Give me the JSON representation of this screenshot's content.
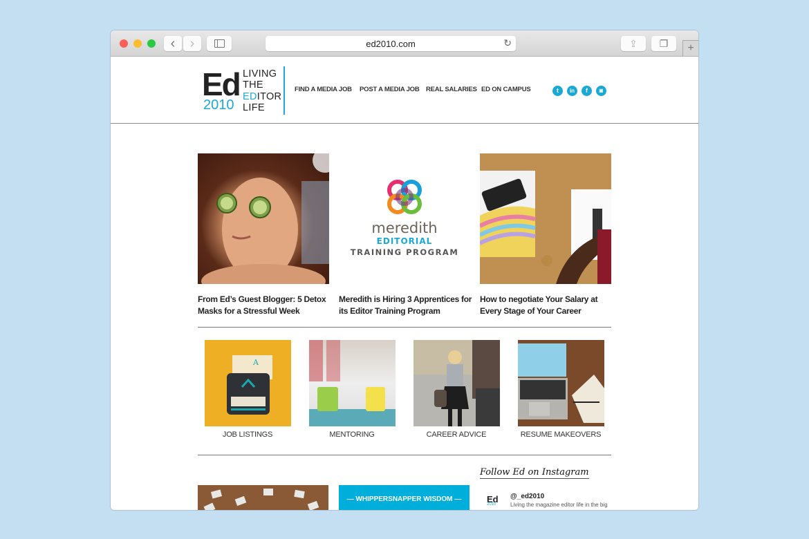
{
  "browser": {
    "url": "ed2010.com",
    "icons": {
      "back": "chevron-left-icon",
      "forward": "chevron-right-icon",
      "sidebar": "sidebar-icon",
      "reload": "reload-icon",
      "share": "share-icon",
      "tabs": "tabs-icon",
      "new_tab": "plus-icon"
    },
    "glyphs": {
      "back": "‹",
      "forward": "›",
      "reload": "↻",
      "share": "⇪",
      "tabs": "❐",
      "new_tab": "+"
    }
  },
  "site": {
    "logo": {
      "ed": "Ed",
      "year": "2010",
      "tag_line1": "LIVING",
      "tag_line2": "THE",
      "tag_line3_blue": "ED",
      "tag_line3_rest": "ITOR",
      "tag_line4": "LIFE"
    },
    "nav": [
      {
        "label": "FIND A MEDIA JOB"
      },
      {
        "label": "POST A MEDIA JOB"
      },
      {
        "label": "REAL SALARIES"
      },
      {
        "label": "ED ON CAMPUS"
      }
    ],
    "social": [
      {
        "name": "twitter-icon",
        "glyph": "t"
      },
      {
        "name": "linkedin-icon",
        "glyph": "in"
      },
      {
        "name": "facebook-icon",
        "glyph": "f"
      },
      {
        "name": "instagram-icon",
        "glyph": "◙"
      }
    ],
    "accent_color": "#1aa9d6"
  },
  "featured": [
    {
      "title": "From Ed’s Guest Blogger: 5 Detox Masks for a Stressful Week",
      "image": "woman-cucumber-mask-photo"
    },
    {
      "title": "Meredith is Hiring 3 Apprentices for its Editor Training Program",
      "image": "meredith-logo",
      "logo_word": "meredith",
      "logo_line2": "EDITORIAL",
      "logo_line3": "TRAINING PROGRAM"
    },
    {
      "title": "How to negotiate Your Salary at Every Stage of Your Career",
      "image": "desk-phone-notebook-photo"
    }
  ],
  "categories": [
    {
      "label": "JOB LISTINGS",
      "image": "typewriter-illustration"
    },
    {
      "label": "MENTORING",
      "image": "two-mugs-photo"
    },
    {
      "label": "CAREER ADVICE",
      "image": "woman-on-phone-photo"
    },
    {
      "label": "RESUME MAKEOVERS",
      "image": "laptop-notebook-photo"
    }
  ],
  "bottom": {
    "whippersnapper": "— WHIPPERSNAPPER WISDOM —",
    "instagram_title": "Follow Ed on Instagram",
    "instagram_handle": "@_ed2010",
    "instagram_bio": "Living the magazine editor life in the big"
  }
}
